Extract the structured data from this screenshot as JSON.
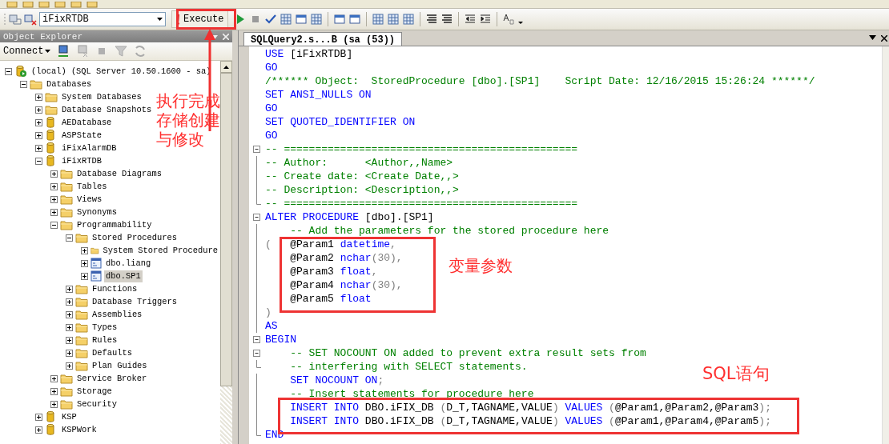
{
  "toolbar": {
    "database": "iFixRTDB",
    "execute": "Execute"
  },
  "object_explorer": {
    "title": "Object Explorer",
    "connect": "Connect",
    "tree": [
      {
        "label": "(local) (SQL Server 10.50.1600 - sa)",
        "kind": "server",
        "expanded": true,
        "selected": false,
        "children": [
          {
            "label": "Databases",
            "kind": "folder",
            "expanded": true,
            "selected": false,
            "children": [
              {
                "label": "System Databases",
                "kind": "folder",
                "expanded": false,
                "selected": false
              },
              {
                "label": "Database Snapshots",
                "kind": "folder",
                "expanded": false,
                "selected": false
              },
              {
                "label": "AEDatabase",
                "kind": "database",
                "expanded": false,
                "selected": false
              },
              {
                "label": "ASPState",
                "kind": "database",
                "expanded": false,
                "selected": false
              },
              {
                "label": "iFixAlarmDB",
                "kind": "database",
                "expanded": false,
                "selected": false
              },
              {
                "label": "iFixRTDB",
                "kind": "database",
                "expanded": true,
                "selected": false,
                "children": [
                  {
                    "label": "Database Diagrams",
                    "kind": "folder",
                    "expanded": false,
                    "selected": false
                  },
                  {
                    "label": "Tables",
                    "kind": "folder",
                    "expanded": false,
                    "selected": false
                  },
                  {
                    "label": "Views",
                    "kind": "folder",
                    "expanded": false,
                    "selected": false
                  },
                  {
                    "label": "Synonyms",
                    "kind": "folder",
                    "expanded": false,
                    "selected": false
                  },
                  {
                    "label": "Programmability",
                    "kind": "folder",
                    "expanded": true,
                    "selected": false,
                    "children": [
                      {
                        "label": "Stored Procedures",
                        "kind": "folder",
                        "expanded": true,
                        "selected": false,
                        "children": [
                          {
                            "label": "System Stored Procedure",
                            "kind": "folder",
                            "expanded": false,
                            "selected": false
                          },
                          {
                            "label": "dbo.liang",
                            "kind": "procedure",
                            "expanded": false,
                            "selected": false
                          },
                          {
                            "label": "dbo.SP1",
                            "kind": "procedure",
                            "expanded": false,
                            "selected": true
                          }
                        ]
                      },
                      {
                        "label": "Functions",
                        "kind": "folder",
                        "expanded": false,
                        "selected": false
                      },
                      {
                        "label": "Database Triggers",
                        "kind": "folder",
                        "expanded": false,
                        "selected": false
                      },
                      {
                        "label": "Assemblies",
                        "kind": "folder",
                        "expanded": false,
                        "selected": false
                      },
                      {
                        "label": "Types",
                        "kind": "folder",
                        "expanded": false,
                        "selected": false
                      },
                      {
                        "label": "Rules",
                        "kind": "folder",
                        "expanded": false,
                        "selected": false
                      },
                      {
                        "label": "Defaults",
                        "kind": "folder",
                        "expanded": false,
                        "selected": false
                      },
                      {
                        "label": "Plan Guides",
                        "kind": "folder",
                        "expanded": false,
                        "selected": false
                      }
                    ]
                  },
                  {
                    "label": "Service Broker",
                    "kind": "folder",
                    "expanded": false,
                    "selected": false
                  },
                  {
                    "label": "Storage",
                    "kind": "folder",
                    "expanded": false,
                    "selected": false
                  },
                  {
                    "label": "Security",
                    "kind": "folder",
                    "expanded": false,
                    "selected": false
                  }
                ]
              },
              {
                "label": "KSP",
                "kind": "database",
                "expanded": false,
                "selected": false
              },
              {
                "label": "KSPWork",
                "kind": "database",
                "expanded": false,
                "selected": false
              }
            ]
          }
        ]
      }
    ]
  },
  "editor": {
    "tab": {
      "label": "SQLQuery2.s...B (sa (53))",
      "selected": true
    },
    "lines": [
      {
        "kind": "plain",
        "tokens": [
          {
            "kind": "kw",
            "text": "USE"
          },
          {
            "kind": "plain",
            "text": " [iFixRTDB]"
          }
        ]
      },
      {
        "kind": "plain",
        "tokens": [
          {
            "kind": "kw",
            "text": "GO"
          }
        ]
      },
      {
        "kind": "plain",
        "tokens": [
          {
            "kind": "comment",
            "text": "/****** Object:  StoredProcedure [dbo].[SP1]    Script Date: 12/16/2015 15:26:24 ******/"
          }
        ]
      },
      {
        "kind": "plain",
        "tokens": [
          {
            "kind": "kw",
            "text": "SET ANSI_NULLS ON"
          }
        ]
      },
      {
        "kind": "plain",
        "tokens": [
          {
            "kind": "kw",
            "text": "GO"
          }
        ]
      },
      {
        "kind": "plain",
        "tokens": [
          {
            "kind": "kw",
            "text": "SET QUOTED_IDENTIFIER ON"
          }
        ]
      },
      {
        "kind": "plain",
        "tokens": [
          {
            "kind": "kw",
            "text": "GO"
          }
        ]
      },
      {
        "kind": "fold-start",
        "tokens": [
          {
            "kind": "comment",
            "text": "-- ==============================================="
          }
        ]
      },
      {
        "kind": "fold-body",
        "tokens": [
          {
            "kind": "comment",
            "text": "-- Author:      <Author,,Name>"
          }
        ]
      },
      {
        "kind": "fold-body",
        "tokens": [
          {
            "kind": "comment",
            "text": "-- Create date: <Create Date,,>"
          }
        ]
      },
      {
        "kind": "fold-body",
        "tokens": [
          {
            "kind": "comment",
            "text": "-- Description: <Description,,>"
          }
        ]
      },
      {
        "kind": "fold-end",
        "tokens": [
          {
            "kind": "comment",
            "text": "-- ==============================================="
          }
        ]
      },
      {
        "kind": "fold-start",
        "tokens": [
          {
            "kind": "kw",
            "text": "ALTER PROCEDURE"
          },
          {
            "kind": "plain",
            "text": " [dbo].[SP1]"
          }
        ]
      },
      {
        "kind": "fold-body",
        "tokens": [
          {
            "kind": "comment",
            "text": "    -- Add the parameters for the stored procedure here"
          }
        ]
      },
      {
        "kind": "fold-body",
        "tokens": [
          {
            "kind": "gray",
            "text": "("
          },
          {
            "kind": "plain",
            "text": "   @Param1 "
          },
          {
            "kind": "kw",
            "text": "datetime"
          },
          {
            "kind": "gray",
            "text": ","
          }
        ]
      },
      {
        "kind": "fold-body",
        "tokens": [
          {
            "kind": "plain",
            "text": "    @Param2 "
          },
          {
            "kind": "kw",
            "text": "nchar"
          },
          {
            "kind": "gray",
            "text": "(30),"
          }
        ]
      },
      {
        "kind": "fold-body",
        "tokens": [
          {
            "kind": "plain",
            "text": "    @Param3 "
          },
          {
            "kind": "kw",
            "text": "float"
          },
          {
            "kind": "gray",
            "text": ","
          }
        ]
      },
      {
        "kind": "fold-body",
        "tokens": [
          {
            "kind": "plain",
            "text": "    @Param4 "
          },
          {
            "kind": "kw",
            "text": "nchar"
          },
          {
            "kind": "gray",
            "text": "(30),"
          }
        ]
      },
      {
        "kind": "fold-body",
        "tokens": [
          {
            "kind": "plain",
            "text": "    @Param5 "
          },
          {
            "kind": "kw",
            "text": "float"
          }
        ]
      },
      {
        "kind": "fold-body",
        "tokens": [
          {
            "kind": "gray",
            "text": ")"
          }
        ]
      },
      {
        "kind": "fold-body",
        "tokens": [
          {
            "kind": "kw",
            "text": "AS"
          }
        ]
      },
      {
        "kind": "fold-start",
        "tokens": [
          {
            "kind": "kw",
            "text": "BEGIN"
          }
        ]
      },
      {
        "kind": "fold-start",
        "tokens": [
          {
            "kind": "comment",
            "text": "    -- SET NOCOUNT ON added to prevent extra result sets from"
          }
        ]
      },
      {
        "kind": "fold-end",
        "tokens": [
          {
            "kind": "comment",
            "text": "    -- interfering with SELECT statements."
          }
        ]
      },
      {
        "kind": "fold-body",
        "tokens": [
          {
            "kind": "kw",
            "text": "    SET NOCOUNT ON"
          },
          {
            "kind": "gray",
            "text": ";"
          }
        ]
      },
      {
        "kind": "fold-body",
        "tokens": [
          {
            "kind": "comment",
            "text": "    -- Insert statements for procedure here"
          }
        ]
      },
      {
        "kind": "fold-body",
        "tokens": [
          {
            "kind": "kw",
            "text": "    INSERT INTO"
          },
          {
            "kind": "plain",
            "text": " DBO.iFIX_DB "
          },
          {
            "kind": "gray",
            "text": "("
          },
          {
            "kind": "plain",
            "text": "D_T,TAGNAME,VALUE"
          },
          {
            "kind": "gray",
            "text": ") "
          },
          {
            "kind": "kw",
            "text": "VALUES"
          },
          {
            "kind": "gray",
            "text": " ("
          },
          {
            "kind": "plain",
            "text": "@Param1,@Param2,@Param3"
          },
          {
            "kind": "gray",
            "text": ");"
          }
        ]
      },
      {
        "kind": "fold-body",
        "tokens": [
          {
            "kind": "kw",
            "text": "    INSERT INTO"
          },
          {
            "kind": "plain",
            "text": " DBO.iFIX_DB "
          },
          {
            "kind": "gray",
            "text": "("
          },
          {
            "kind": "plain",
            "text": "D_T,TAGNAME,VALUE"
          },
          {
            "kind": "gray",
            "text": ") "
          },
          {
            "kind": "kw",
            "text": "VALUES"
          },
          {
            "kind": "gray",
            "text": " ("
          },
          {
            "kind": "plain",
            "text": "@Param1,@Param4,@Param5"
          },
          {
            "kind": "gray",
            "text": ");"
          }
        ]
      },
      {
        "kind": "fold-end",
        "tokens": [
          {
            "kind": "kw",
            "text": "END"
          }
        ]
      }
    ]
  },
  "annotations": [
    {
      "lines": [
        "执行完成",
        "存储创建",
        "与修改"
      ]
    },
    {
      "lines": [
        "变量参数"
      ]
    },
    {
      "lines": [
        "SQL语句"
      ]
    }
  ]
}
